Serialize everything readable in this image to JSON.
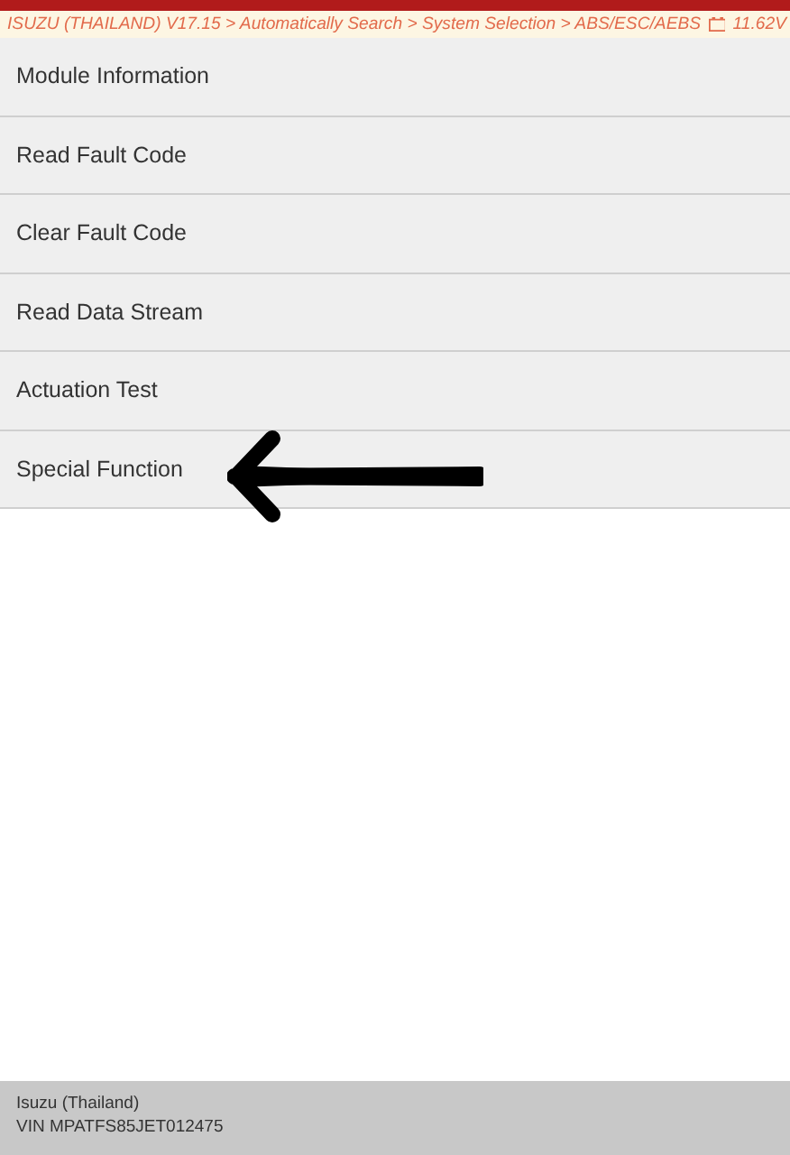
{
  "breadcrumb": {
    "path": "ISUZU (THAILAND) V17.15 > Automatically Search > System Selection > ABS/ESC/AEBS",
    "voltage": "11.62V"
  },
  "menu": [
    {
      "label": "Module Information"
    },
    {
      "label": "Read Fault Code"
    },
    {
      "label": "Clear Fault Code"
    },
    {
      "label": "Read Data Stream"
    },
    {
      "label": "Actuation Test"
    },
    {
      "label": "Special Function"
    }
  ],
  "footer": {
    "make": "Isuzu (Thailand)",
    "vin": "VIN MPATFS85JET012475"
  }
}
